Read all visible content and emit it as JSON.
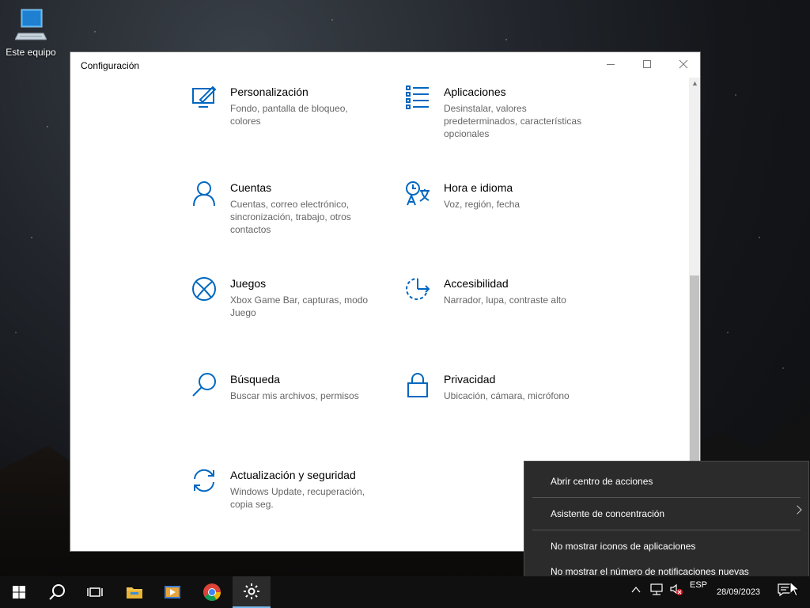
{
  "desktop": {
    "icon_label": "Este equipo"
  },
  "window": {
    "title": "Configuración",
    "tiles": [
      {
        "name": "Personalización",
        "desc": "Fondo, pantalla de bloqueo, colores",
        "icon": "paint-brush-icon"
      },
      {
        "name": "Aplicaciones",
        "desc": "Desinstalar, valores predeterminados, características opcionales",
        "icon": "apps-list-icon"
      },
      {
        "name": "Cuentas",
        "desc": "Cuentas, correo electrónico, sincronización, trabajo, otros contactos",
        "icon": "person-icon"
      },
      {
        "name": "Hora e idioma",
        "desc": "Voz, región, fecha",
        "icon": "time-language-icon"
      },
      {
        "name": "Juegos",
        "desc": "Xbox Game Bar, capturas, modo Juego",
        "icon": "xbox-icon"
      },
      {
        "name": "Accesibilidad",
        "desc": "Narrador, lupa, contraste alto",
        "icon": "accessibility-icon"
      },
      {
        "name": "Búsqueda",
        "desc": "Buscar mis archivos, permisos",
        "icon": "search-icon"
      },
      {
        "name": "Privacidad",
        "desc": "Ubicación, cámara, micrófono",
        "icon": "lock-icon"
      },
      {
        "name": "Actualización y seguridad",
        "desc": "Windows Update, recuperación, copia seg.",
        "icon": "sync-icon"
      }
    ]
  },
  "context_menu": {
    "items": [
      "Abrir centro de acciones",
      "Asistente de concentración",
      "No mostrar iconos de aplicaciones",
      "No mostrar el número de notificaciones nuevas"
    ]
  },
  "taskbar": {
    "language": "ESP",
    "date": "28/09/2023"
  },
  "colors": {
    "accent": "#0067c0",
    "menu_bg": "#2b2b2b",
    "taskbar_bg": "#101010"
  }
}
